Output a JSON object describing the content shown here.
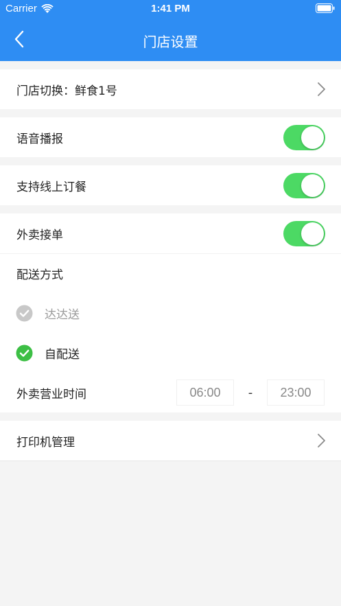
{
  "status_bar": {
    "carrier": "Carrier",
    "time": "1:41 PM"
  },
  "nav": {
    "title": "门店设置"
  },
  "store_switch": {
    "label": "门店切换：鲜食1号"
  },
  "voice_broadcast": {
    "label": "语音播报",
    "enabled": true
  },
  "online_order": {
    "label": "支持线上订餐",
    "enabled": true
  },
  "takeout": {
    "label": "外卖接单",
    "enabled": true,
    "delivery_method_label": "配送方式",
    "options": [
      {
        "label": "达达送",
        "selected": false,
        "disabled": true
      },
      {
        "label": "自配送",
        "selected": true,
        "disabled": false
      }
    ],
    "hours_label": "外卖营业时间",
    "start_time": "06:00",
    "separator": "-",
    "end_time": "23:00"
  },
  "printer": {
    "label": "打印机管理"
  },
  "colors": {
    "header": "#2e8df3",
    "toggle_on": "#4cd964",
    "check_selected": "#3dbf45",
    "check_disabled": "#c8c8c8"
  },
  "icons": [
    "wifi-icon",
    "battery-icon",
    "back-icon",
    "chevron-right-icon",
    "check-circle-icon"
  ]
}
